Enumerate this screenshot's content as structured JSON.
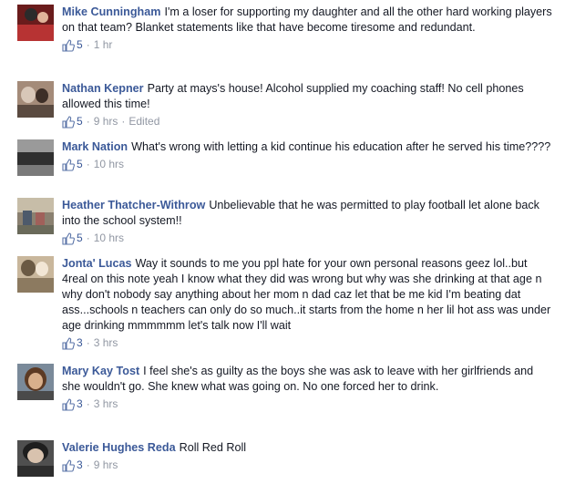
{
  "comments": [
    {
      "author": "Mike Cunningham",
      "text": "I'm a loser for supporting my daughter and all the other hard working players on that team? Blanket statements like that have become tiresome and redundant.",
      "likes": "5",
      "time": "1 hr",
      "edited": "",
      "avatar_colors": [
        "#6a1c1c",
        "#b73333",
        "#2b2b2b"
      ]
    },
    {
      "author": "Nathan Kepner",
      "text": "Party at mays's house! Alcohol supplied my coaching staff! No cell phones allowed this time!",
      "likes": "5",
      "time": "9 hrs",
      "edited": "Edited",
      "avatar_colors": [
        "#a48b79",
        "#d8c7b8",
        "#3d2e27"
      ]
    },
    {
      "author": "Mark Nation",
      "text": "What's wrong with letting a kid continue his education after he served his time????",
      "likes": "5",
      "time": "10 hrs",
      "edited": "",
      "avatar_colors": [
        "#2f2f2f",
        "#5e5e5e",
        "#9a9a9a"
      ]
    },
    {
      "author": "Heather Thatcher-Withrow",
      "text": "Unbelievable that he was permitted to play football let alone back into the school system!!",
      "likes": "5",
      "time": "10 hrs",
      "edited": "",
      "avatar_colors": [
        "#8a8070",
        "#c7bda8",
        "#4d5a6b"
      ]
    },
    {
      "author": "Jonta' Lucas",
      "text": "Way it sounds to me you ppl hate for your own personal reasons geez lol..but 4real on this note yeah I know what they did was wrong but why was she drinking at that age n why don't nobody say anything about her mom n dad caz let that be me kid I'm beating dat ass...schools n teachers can only do so much..it starts from the home n her lil hot ass was under age drinking mmmmmm let's talk now I'll wait",
      "likes": "3",
      "time": "3 hrs",
      "edited": "",
      "avatar_colors": [
        "#c9b79c",
        "#f2e6d5",
        "#6b5a44"
      ]
    },
    {
      "author": "Mary Kay Tost",
      "text": "I feel she's as guilty as the boys she was ask to leave with her girlfriends and she wouldn't go. She knew what was going on. No one forced her to drink.",
      "likes": "3",
      "time": "3 hrs",
      "edited": "",
      "avatar_colors": [
        "#5c3a24",
        "#d9b08c",
        "#7a8a9a"
      ]
    },
    {
      "author": "Valerie Hughes Reda",
      "text": "Roll Red Roll",
      "likes": "3",
      "time": "9 hrs",
      "edited": "",
      "avatar_colors": [
        "#1e1e1e",
        "#d8c2ae",
        "#4f4f4f"
      ]
    }
  ],
  "ui": {
    "separator": "·",
    "like_icon": "thumbs-up-icon"
  }
}
